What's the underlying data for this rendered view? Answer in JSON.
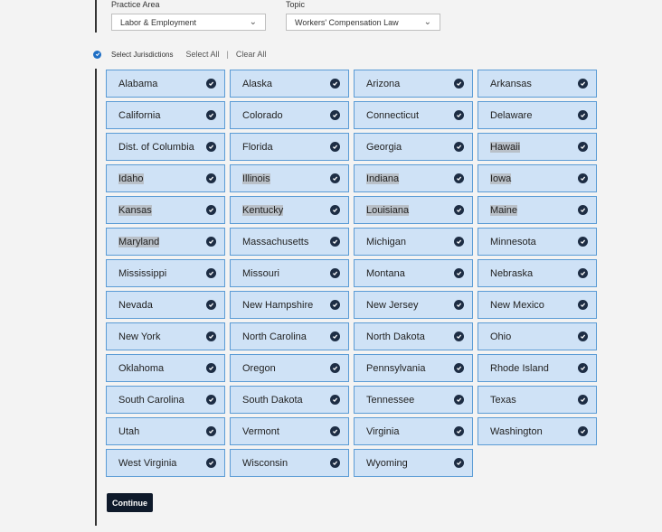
{
  "filters": {
    "practice_area": {
      "label": "Practice Area",
      "value": "Labor & Employment"
    },
    "topic": {
      "label": "Topic",
      "value": "Workers' Compensation Law"
    }
  },
  "jurisdictions": {
    "label": "Select Jurisdictions",
    "select_all": "Select All",
    "separator": "|",
    "clear_all": "Clear All",
    "items": [
      {
        "name": "Alabama",
        "highlighted": false
      },
      {
        "name": "Alaska",
        "highlighted": false
      },
      {
        "name": "Arizona",
        "highlighted": false
      },
      {
        "name": "Arkansas",
        "highlighted": false
      },
      {
        "name": "California",
        "highlighted": false
      },
      {
        "name": "Colorado",
        "highlighted": false
      },
      {
        "name": "Connecticut",
        "highlighted": false
      },
      {
        "name": "Delaware",
        "highlighted": false
      },
      {
        "name": "Dist. of Columbia",
        "highlighted": false
      },
      {
        "name": "Florida",
        "highlighted": false
      },
      {
        "name": "Georgia",
        "highlighted": false
      },
      {
        "name": "Hawaii",
        "highlighted": true
      },
      {
        "name": "Idaho",
        "highlighted": true
      },
      {
        "name": "Illinois",
        "highlighted": true
      },
      {
        "name": "Indiana",
        "highlighted": true
      },
      {
        "name": "Iowa",
        "highlighted": true
      },
      {
        "name": "Kansas",
        "highlighted": true
      },
      {
        "name": "Kentucky",
        "highlighted": true
      },
      {
        "name": "Louisiana",
        "highlighted": true
      },
      {
        "name": "Maine",
        "highlighted": true
      },
      {
        "name": "Maryland",
        "highlighted": true
      },
      {
        "name": "Massachusetts",
        "highlighted": false
      },
      {
        "name": "Michigan",
        "highlighted": false
      },
      {
        "name": "Minnesota",
        "highlighted": false
      },
      {
        "name": "Mississippi",
        "highlighted": false
      },
      {
        "name": "Missouri",
        "highlighted": false
      },
      {
        "name": "Montana",
        "highlighted": false
      },
      {
        "name": "Nebraska",
        "highlighted": false
      },
      {
        "name": "Nevada",
        "highlighted": false
      },
      {
        "name": "New Hampshire",
        "highlighted": false
      },
      {
        "name": "New Jersey",
        "highlighted": false
      },
      {
        "name": "New Mexico",
        "highlighted": false
      },
      {
        "name": "New York",
        "highlighted": false
      },
      {
        "name": "North Carolina",
        "highlighted": false
      },
      {
        "name": "North Dakota",
        "highlighted": false
      },
      {
        "name": "Ohio",
        "highlighted": false
      },
      {
        "name": "Oklahoma",
        "highlighted": false
      },
      {
        "name": "Oregon",
        "highlighted": false
      },
      {
        "name": "Pennsylvania",
        "highlighted": false
      },
      {
        "name": "Rhode Island",
        "highlighted": false
      },
      {
        "name": "South Carolina",
        "highlighted": false
      },
      {
        "name": "South Dakota",
        "highlighted": false
      },
      {
        "name": "Tennessee",
        "highlighted": false
      },
      {
        "name": "Texas",
        "highlighted": false
      },
      {
        "name": "Utah",
        "highlighted": false
      },
      {
        "name": "Vermont",
        "highlighted": false
      },
      {
        "name": "Virginia",
        "highlighted": false
      },
      {
        "name": "Washington",
        "highlighted": false
      },
      {
        "name": "West Virginia",
        "highlighted": false
      },
      {
        "name": "Wisconsin",
        "highlighted": false
      },
      {
        "name": "Wyoming",
        "highlighted": false
      }
    ]
  },
  "continue_label": "Continue",
  "colors": {
    "tile_bg": "#cfe2f6",
    "tile_border": "#5a9bd5",
    "check_bg": "#1d2d44",
    "button_bg": "#0f1a2b",
    "accent": "#1f6fc5"
  }
}
